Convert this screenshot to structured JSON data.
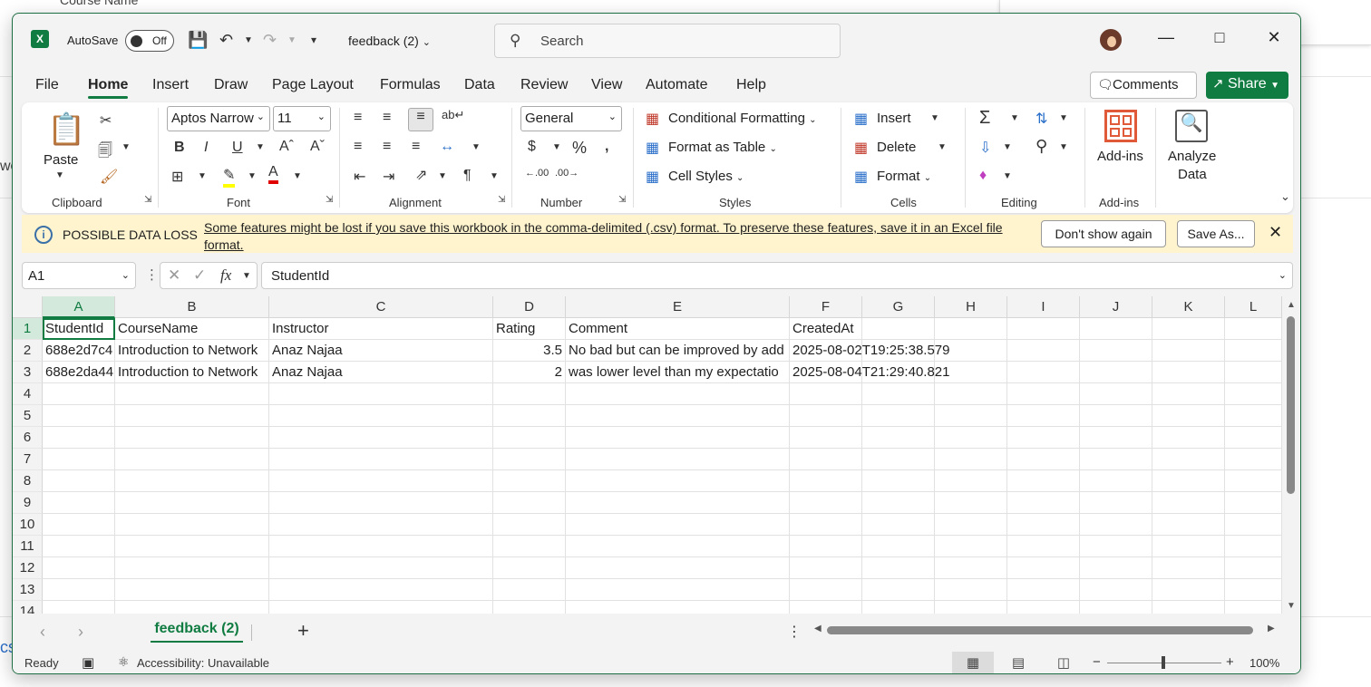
{
  "window": {
    "filename": "feedback (2)",
    "autosave_label": "AutoSave",
    "autosave_state": "Off",
    "search_placeholder": "Search"
  },
  "menu": [
    "File",
    "Home",
    "Insert",
    "Draw",
    "Page Layout",
    "Formulas",
    "Data",
    "Review",
    "View",
    "Automate",
    "Help"
  ],
  "header_buttons": {
    "comments": "Comments",
    "share": "Share"
  },
  "ribbon": {
    "clipboard": {
      "label": "Clipboard",
      "paste": "Paste"
    },
    "font": {
      "label": "Font",
      "family": "Aptos Narrow",
      "size": "11"
    },
    "alignment": {
      "label": "Alignment"
    },
    "number": {
      "label": "Number",
      "format": "General"
    },
    "styles": {
      "label": "Styles",
      "conditional": "Conditional Formatting",
      "table": "Format as Table",
      "cell_styles": "Cell Styles"
    },
    "cells": {
      "label": "Cells",
      "insert": "Insert",
      "delete": "Delete",
      "format": "Format"
    },
    "editing": {
      "label": "Editing"
    },
    "addins": {
      "label": "Add-ins",
      "button": "Add-ins"
    },
    "analyze": {
      "button_line1": "Analyze",
      "button_line2": "Data"
    }
  },
  "infobar": {
    "title": "POSSIBLE DATA LOSS",
    "message": "Some features might be lost if you save this workbook in the comma-delimited (.csv) format. To preserve these features, save it in an Excel file format.",
    "dont_show": "Don't show again",
    "save_as": "Save As..."
  },
  "formula_bar": {
    "name_box": "A1",
    "content": "StudentId"
  },
  "grid": {
    "columns": [
      "A",
      "B",
      "C",
      "D",
      "E",
      "F",
      "G",
      "H",
      "I",
      "J",
      "K",
      "L"
    ],
    "rows": [
      "1",
      "2",
      "3",
      "4",
      "5",
      "6",
      "7",
      "8",
      "9",
      "10",
      "11",
      "12",
      "13",
      "14"
    ],
    "cells": {
      "A1": "StudentId",
      "B1": "CourseName",
      "C1": "Instructor",
      "D1": "Rating",
      "E1": "Comment",
      "F1": "CreatedAt",
      "A2": "688e2d7c4",
      "B2": "Introduction to Network",
      "C2": "Anaz Najaa",
      "D2": "3.5",
      "E2": "No bad but can be improved by add",
      "F2": "2025-08-02T19:25:38.579",
      "A3": "688e2da44",
      "B3": "Introduction to Network",
      "C3": "Anaz Najaa",
      "D3": "2",
      "E3": "was lower level than my expectatio",
      "F3": "2025-08-04T21:29:40.821"
    }
  },
  "sheet_tab": "feedback (2)",
  "status": {
    "ready": "Ready",
    "accessibility": "Accessibility: Unavailable",
    "zoom": "100%"
  },
  "background": {
    "frag1": "Course Name",
    "frag2": "wo",
    "frag3": "cs"
  },
  "colors": {
    "excel_green": "#107c41",
    "info_bg": "#fff4ce"
  }
}
